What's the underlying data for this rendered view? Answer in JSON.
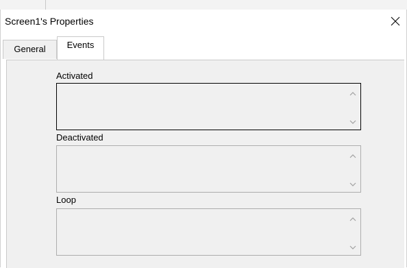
{
  "window": {
    "title": "Screen1's Properties"
  },
  "tabs": [
    {
      "label": "General",
      "active": false
    },
    {
      "label": "Events",
      "active": true
    }
  ],
  "fields": [
    {
      "label": "Activated",
      "value": ""
    },
    {
      "label": "Deactivated",
      "value": ""
    },
    {
      "label": "Loop",
      "value": ""
    }
  ],
  "icons": {
    "close": "close-icon",
    "scroll_up": "chevron-up-icon",
    "scroll_down": "chevron-down-icon"
  },
  "colors": {
    "panel": "#f0f0f0",
    "border": "#adadad",
    "focus_border": "#000000"
  }
}
